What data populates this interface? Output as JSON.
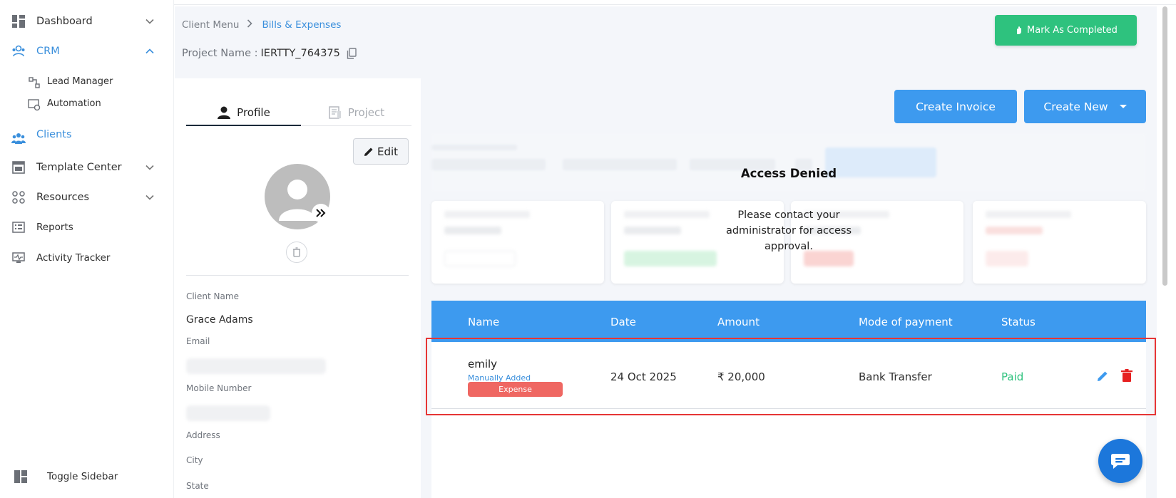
{
  "sidebar": {
    "items": [
      {
        "label": "Dashboard",
        "icon": "dashboard-icon"
      },
      {
        "label": "CRM",
        "icon": "crm-icon"
      },
      {
        "label": "Clients",
        "icon": "clients-icon"
      },
      {
        "label": "Template Center",
        "icon": "template-icon"
      },
      {
        "label": "Resources",
        "icon": "resources-icon"
      },
      {
        "label": "Reports",
        "icon": "reports-icon"
      },
      {
        "label": "Activity Tracker",
        "icon": "activity-icon"
      }
    ],
    "crm_sub": [
      {
        "label": "Lead Manager",
        "icon": "lead-manager-icon"
      },
      {
        "label": "Automation",
        "icon": "automation-icon"
      }
    ],
    "toggle_label": "Toggle Sidebar",
    "active_color": "#3a8fdc"
  },
  "breadcrumb": {
    "parent": "Client Menu",
    "current": "Bills & Expenses"
  },
  "project": {
    "label": "Project Name :",
    "value": "IERTTY_764375"
  },
  "header": {
    "mark_completed": "Mark As Completed"
  },
  "profile": {
    "tabs": {
      "profile": "Profile",
      "project": "Project"
    },
    "edit_label": "Edit",
    "fields": {
      "client_name_label": "Client Name",
      "client_name": "Grace Adams",
      "email_label": "Email",
      "mobile_label": "Mobile Number",
      "address_label": "Address",
      "city_label": "City",
      "state_label": "State"
    }
  },
  "actions": {
    "create_invoice": "Create Invoice",
    "create_new": "Create New"
  },
  "access": {
    "title": "Access Denied",
    "message": "Please contact your administrator for access approval."
  },
  "table": {
    "headers": [
      "Name",
      "Date",
      "Amount",
      "Mode of payment",
      "Status"
    ],
    "rows": [
      {
        "name": "emily",
        "sub": "Manually Added",
        "badge": "Expense",
        "date": "24 Oct 2025",
        "amount": "₹ 20,000",
        "mode": "Bank Transfer",
        "status": "Paid"
      }
    ]
  },
  "colors": {
    "primary": "#3d9aef",
    "success": "#2ec27e",
    "danger": "#e63535",
    "expense": "#ef6762"
  }
}
